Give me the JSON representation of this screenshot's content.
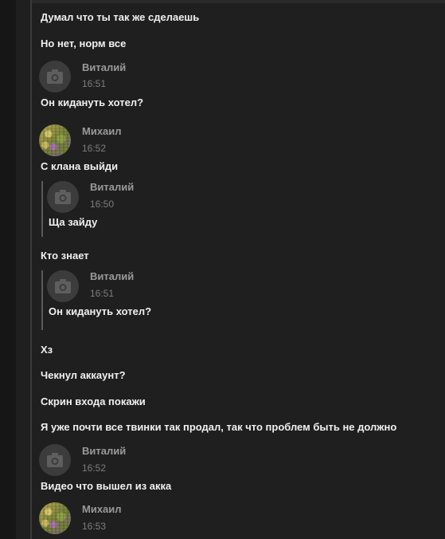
{
  "messages": [
    {
      "text": "Думал что ты так же сделаешь"
    },
    {
      "text": "Но нет, норм все"
    },
    {
      "author": "Виталий",
      "time": "16:51"
    },
    {
      "text": "Он кидануть хотел?"
    },
    {
      "author": "Михаил",
      "time": "16:52"
    },
    {
      "text": "С клана выйди"
    },
    {
      "quote": {
        "author": "Виталий",
        "time": "16:50",
        "text": "Ща зайду"
      }
    },
    {
      "text": "Кто знает"
    },
    {
      "quote": {
        "author": "Виталий",
        "time": "16:51",
        "text": "Он кидануть хотел?"
      }
    },
    {
      "text": "Хз"
    },
    {
      "text": "Чекнул аккаунт?"
    },
    {
      "text": "Скрин входа покажи"
    },
    {
      "text": "Я уже почти все твинки так продал, так что проблем быть не должно"
    },
    {
      "author": "Виталий",
      "time": "16:52"
    },
    {
      "text": "Видео что вышел из акка"
    },
    {
      "author": "Михаил",
      "time": "16:53"
    }
  ]
}
